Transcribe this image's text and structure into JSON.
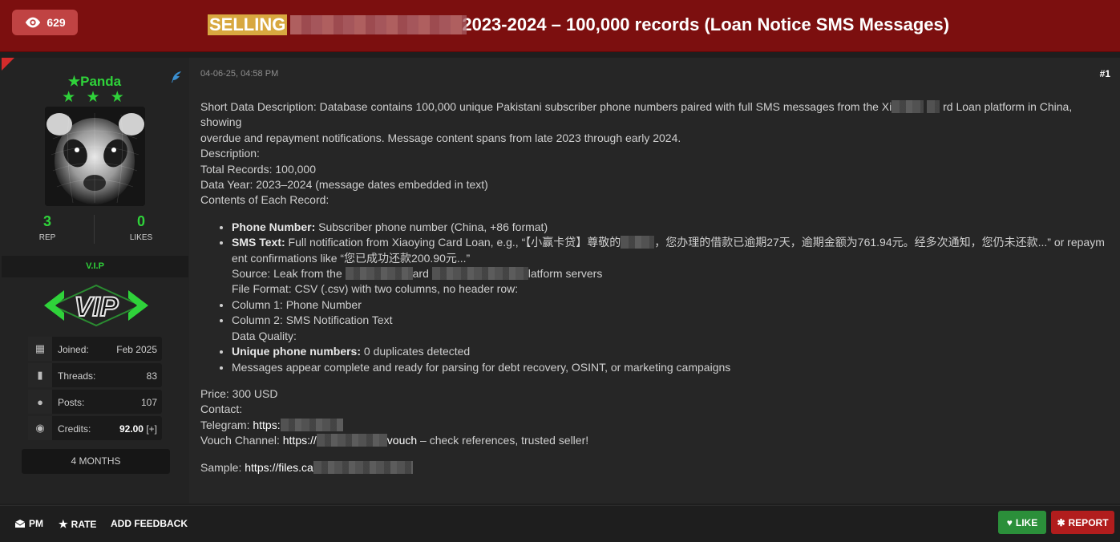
{
  "header": {
    "views": "629",
    "tag": "SELLING",
    "title_rest": "2023-2024 – 100,000 records (Loan Notice SMS Messages)"
  },
  "user": {
    "username": "Panda",
    "stars": "★ ★ ★",
    "rep": "3",
    "rep_label": "REP",
    "likes": "0",
    "likes_label": "LIKES",
    "group": "V.I.P",
    "logo_text": "VIP",
    "info": [
      {
        "label": "Joined:",
        "value": "Feb 2025",
        "icon": "calendar-icon"
      },
      {
        "label": "Threads:",
        "value": "83",
        "icon": "book-icon"
      },
      {
        "label": "Posts:",
        "value": "107",
        "icon": "comments-icon"
      },
      {
        "label": "Credits:",
        "value": "92.00",
        "extra": "[+]",
        "icon": "coins-icon"
      }
    ],
    "tenure": "4 MONTHS"
  },
  "post": {
    "date": "04-06-25, 04:58 PM",
    "number": "#1",
    "short_desc_1": "Short Data Description: Database contains 100,000 unique Pakistani subscriber phone numbers paired with full SMS messages from the Xi",
    "short_desc_2": "rd Loan platform in China, showing",
    "short_desc_3": "overdue and repayment notifications. Message content spans from late 2023 through early 2024.",
    "description": "Description:",
    "total_records": "Total Records: 100,000",
    "data_year": "Data Year: 2023–2024 (message dates embedded in text)",
    "contents": "Contents of Each Record:",
    "bullets": {
      "phone_label": "Phone Number:",
      "phone_text": "Subscriber phone number (China, +86 format)",
      "sms_label": "SMS Text:",
      "sms_text_1": "Full notification from Xiaoying Card Loan, e.g., “【小赢卡贷】尊敬的",
      "sms_text_2": "，您办理的借款已逾期27天，逾期金额为761.94元。经多次通知，您仍未还款...” or repaym",
      "sms_text_3": "ent confirmations like “您已成功还款200.90元...”",
      "source_1": "Source: Leak from the",
      "source_2": "ard",
      "source_3": "latform servers",
      "file_format": "File Format: CSV (.csv) with two columns, no header row:",
      "col1": "Column 1: Phone Number",
      "col2": "Column 2: SMS Notification Text",
      "data_quality": "Data Quality:",
      "unique_label": "Unique phone numbers:",
      "unique_text": "0 duplicates detected",
      "messages": "Messages appear complete and ready for parsing for debt recovery, OSINT, or marketing campaigns"
    },
    "price": "Price: 300 USD",
    "contact": "Contact:",
    "telegram_label": "Telegram:",
    "telegram_link": "https:",
    "vouch_label": "Vouch Channel:",
    "vouch_link_1": "https://",
    "vouch_link_2": "vouch",
    "vouch_text": "– check references, trusted seller!",
    "sample_label": "Sample:",
    "sample_link": "https://files.ca"
  },
  "footer": {
    "pm": "PM",
    "rate": "RATE",
    "feedback": "ADD FEEDBACK",
    "like": "LIKE",
    "report": "REPORT"
  }
}
